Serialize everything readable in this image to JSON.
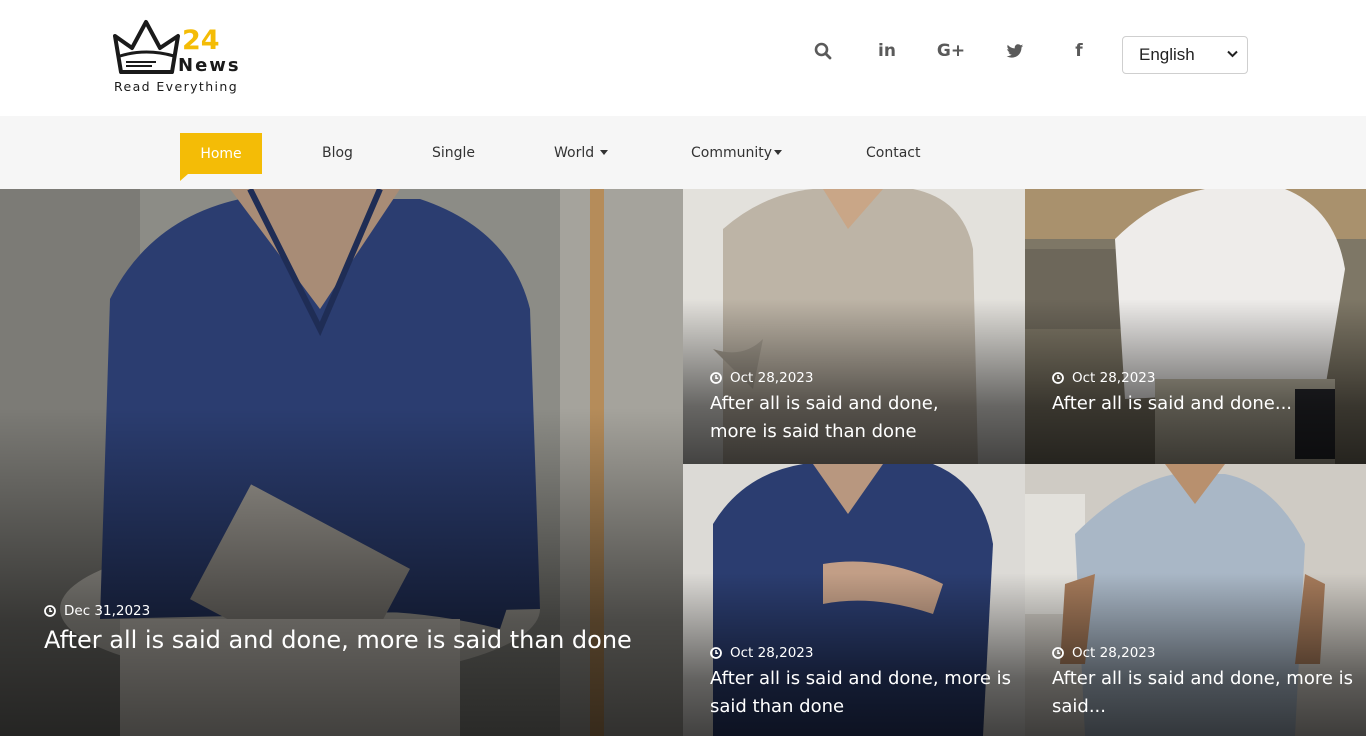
{
  "header": {
    "logo": {
      "number": "24",
      "brand": "News",
      "tagline": "Read Everything"
    },
    "icons": [
      {
        "name": "search-icon"
      },
      {
        "name": "linkedin-icon",
        "text": "in"
      },
      {
        "name": "google-plus-icon",
        "text": "G+"
      },
      {
        "name": "twitter-icon"
      },
      {
        "name": "facebook-icon",
        "text": "f"
      }
    ],
    "language": {
      "selected": "English"
    }
  },
  "nav": {
    "items": [
      {
        "label": "Home",
        "active": true
      },
      {
        "label": "Blog"
      },
      {
        "label": "Single"
      },
      {
        "label": "World",
        "dropdown": true
      },
      {
        "label": "Community",
        "dropdown": true
      },
      {
        "label": "Contact"
      }
    ]
  },
  "posts": {
    "featured": {
      "date": "Dec 31,2023",
      "title": "After all is said and done, more is said than done"
    },
    "p1": {
      "date": "Oct 28,2023",
      "title_line1": "After all is said and done,",
      "title_line2": "more is said than done"
    },
    "p2": {
      "date": "Oct 28,2023",
      "title_line1": "After all is said and done..."
    },
    "p3": {
      "date": "Oct 28,2023",
      "title_line1": "After all is said and done, more is",
      "title_line2": "said than done"
    },
    "p4": {
      "date": "Oct 28,2023",
      "title_line1": "After all is said and done, more is",
      "title_line2": "said..."
    }
  },
  "colors": {
    "accent": "#f4bc06",
    "nav_bg": "#f6f6f6",
    "icon": "#5a5a5a"
  }
}
